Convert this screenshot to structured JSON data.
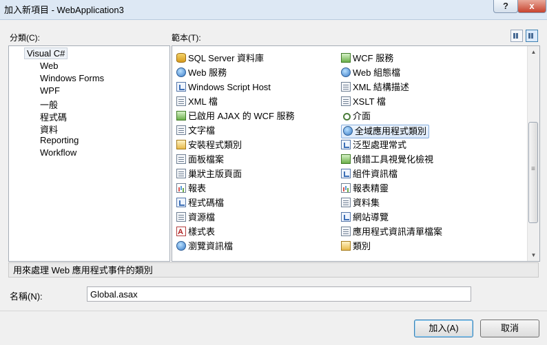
{
  "window": {
    "title": "加入新項目 - WebApplication3",
    "help_btn": "?",
    "close_btn": "x"
  },
  "categories": {
    "label": "分類(C):",
    "items": [
      "Visual C#",
      "Web",
      "Windows Forms",
      "WPF",
      "一般",
      "程式碼",
      "資料",
      "Reporting",
      "Workflow"
    ]
  },
  "templates": {
    "label": "範本(T):",
    "left": [
      {
        "label": "SQL Server 資料庫",
        "icon": "database-icon"
      },
      {
        "label": "Web 服務",
        "icon": "web-service-icon"
      },
      {
        "label": "Windows Script Host",
        "icon": "script-icon"
      },
      {
        "label": "XML 檔",
        "icon": "xml-file-icon"
      },
      {
        "label": "已啟用 AJAX 的 WCF 服務",
        "icon": "ajax-wcf-icon"
      },
      {
        "label": "文字檔",
        "icon": "text-file-icon"
      },
      {
        "label": "安裝程式類別",
        "icon": "installer-class-icon"
      },
      {
        "label": "面板檔案",
        "icon": "skin-file-icon"
      },
      {
        "label": "巢狀主版頁面",
        "icon": "nested-master-page-icon"
      },
      {
        "label": "報表",
        "icon": "report-icon"
      },
      {
        "label": "程式碼檔",
        "icon": "code-file-icon"
      },
      {
        "label": "資源檔",
        "icon": "resource-file-icon"
      },
      {
        "label": "樣式表",
        "icon": "stylesheet-icon"
      },
      {
        "label": "瀏覽資訊檔",
        "icon": "browser-file-icon"
      }
    ],
    "right": [
      {
        "label": "WCF 服務",
        "icon": "wcf-service-icon"
      },
      {
        "label": "Web 組態檔",
        "icon": "web-config-icon"
      },
      {
        "label": "XML 結構描述",
        "icon": "xml-schema-icon"
      },
      {
        "label": "XSLT 檔",
        "icon": "xslt-file-icon"
      },
      {
        "label": "介面",
        "icon": "interface-icon"
      },
      {
        "label": "全域應用程式類別",
        "icon": "global-class-icon"
      },
      {
        "label": "泛型處理常式",
        "icon": "generic-handler-icon"
      },
      {
        "label": "偵錯工具視覺化檢視",
        "icon": "debugger-visualizer-icon"
      },
      {
        "label": "組件資訊檔",
        "icon": "assembly-info-icon"
      },
      {
        "label": "報表精靈",
        "icon": "report-wizard-icon"
      },
      {
        "label": "資料集",
        "icon": "dataset-icon"
      },
      {
        "label": "網站導覽",
        "icon": "sitemap-icon"
      },
      {
        "label": "應用程式資訊清單檔案",
        "icon": "manifest-icon"
      },
      {
        "label": "類別",
        "icon": "class-icon"
      }
    ]
  },
  "description": "用來處理 Web 應用程式事件的類別",
  "name": {
    "label": "名稱(N):",
    "value": "Global.asax"
  },
  "buttons": {
    "add": "加入(A)",
    "cancel": "取消"
  }
}
